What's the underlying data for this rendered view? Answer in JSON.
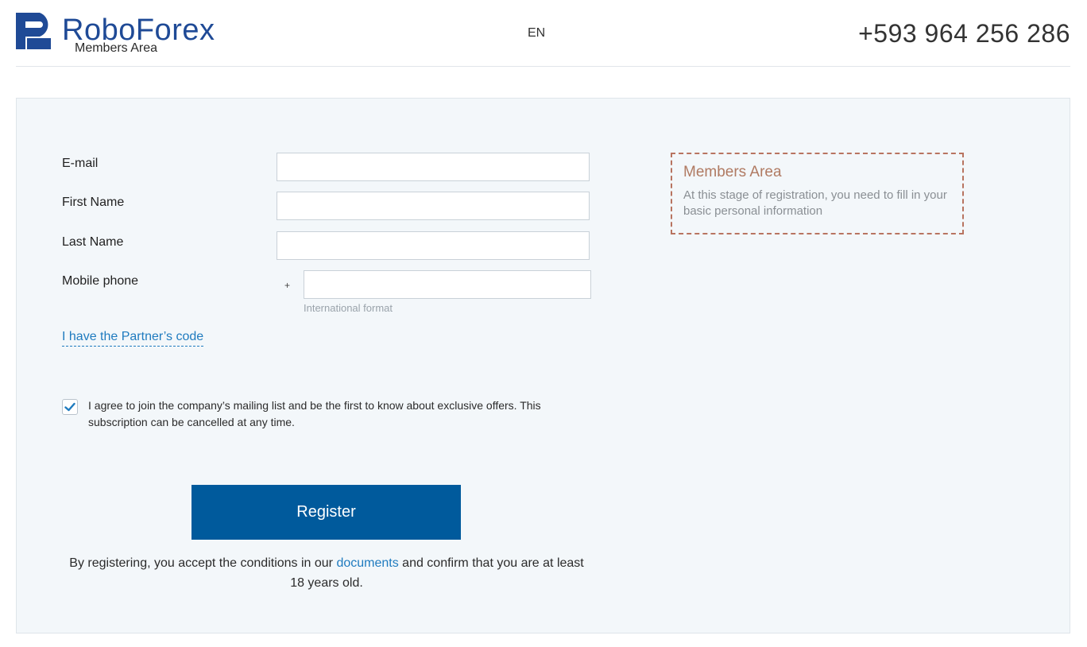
{
  "header": {
    "brand": "RoboForex",
    "sub": "Members Area",
    "lang": "EN",
    "phone": "+593 964 256 286"
  },
  "form": {
    "email_label": "E-mail",
    "email_value": "",
    "first_name_label": "First Name",
    "first_name_value": "",
    "last_name_label": "Last Name",
    "last_name_value": "",
    "mobile_label": "Mobile phone",
    "mobile_prefix": "+",
    "mobile_value": "",
    "mobile_hint": "International format",
    "partner_link": "I have the Partner’s code",
    "mailing_checked": true,
    "mailing_text": "I agree to join the company’s mailing list and be the first to know about exclusive offers. This subscription can be cancelled at any time.",
    "register_label": "Register",
    "terms_before": "By registering, you accept the conditions in our ",
    "terms_link": "documents",
    "terms_after": " and confirm that you are at least 18 years old."
  },
  "info": {
    "title": "Members Area",
    "text": "At this stage of registration, you need to fill in your basic personal information"
  },
  "colors": {
    "brand": "#1f4a96",
    "button": "#005a9c",
    "link": "#1f7bbf",
    "info_border": "#b87460"
  },
  "icons": {
    "logo": "roboforex-logo-icon",
    "check": "checkmark-icon"
  }
}
